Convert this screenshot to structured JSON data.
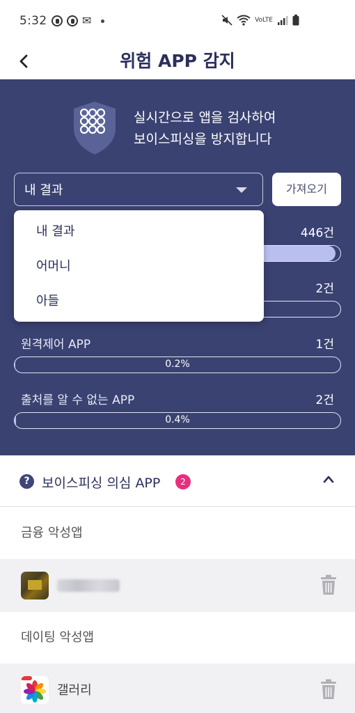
{
  "status_bar": {
    "time": "5:32",
    "lte_label": "VoLTE"
  },
  "header": {
    "title": "위험 APP 감지"
  },
  "hero": {
    "description_line1": "실시간으로 앱을 검사하여",
    "description_line2": "보이스피싱을 방지합니다",
    "selected_result": "내 결과",
    "fetch_label": "가져오기"
  },
  "dropdown": {
    "options": [
      "내 결과",
      "어머니",
      "아들"
    ]
  },
  "stats": [
    {
      "label": "",
      "count": "446건",
      "percent": "",
      "fill": 0.985
    },
    {
      "label": "",
      "count": "2건",
      "percent": "",
      "fill": 0.004
    },
    {
      "label": "원격제어 APP",
      "count": "1건",
      "percent": "0.2%",
      "fill": 0.002
    },
    {
      "label": "출처를 알 수 없는 APP",
      "count": "2건",
      "percent": "0.4%",
      "fill": 0.004
    }
  ],
  "suspicious": {
    "title": "보이스피싱 의심 APP",
    "badge_count": "2",
    "categories": [
      {
        "label": "금융 악성앱"
      },
      {
        "label": "데이팅 악성앱"
      }
    ],
    "apps": [
      {
        "name": "",
        "icon": "blurred-app-icon"
      },
      {
        "name": "갤러리",
        "icon": "gallery-icon"
      }
    ]
  },
  "colors": {
    "panel": "#3a4272",
    "bar_fill": "#b9c0f0",
    "badge": "#ea2e7e",
    "title": "#2c2f5c"
  }
}
